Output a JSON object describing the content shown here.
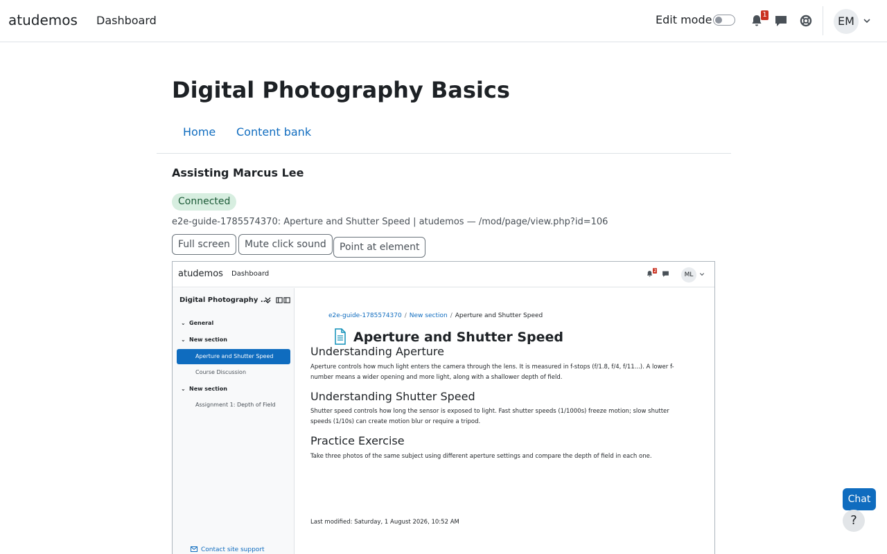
{
  "topbar": {
    "brand": "atudemos",
    "nav_dashboard": "Dashboard",
    "edit_mode_label": "Edit mode",
    "notification_count": "1",
    "user_initials": "EM"
  },
  "page": {
    "title": "Digital Photography Basics",
    "nav": {
      "home": "Home",
      "content_bank": "Content bank"
    }
  },
  "assist": {
    "title": "Assisting Marcus Lee",
    "status": "Connected",
    "location": "e2e-guide-1785574370: Aperture and Shutter Speed | atudemos — /mod/page/view.php?id=106",
    "buttons": {
      "full_screen": "Full screen",
      "mute_click": "Mute click sound",
      "point_element": "Point at element"
    }
  },
  "frame": {
    "brand": "atudemos",
    "nav_dashboard": "Dashboard",
    "notification_count": "2",
    "user_initials": "ML",
    "sidebar": {
      "course": "Digital Photography ...",
      "sections": [
        {
          "label": "General"
        },
        {
          "label": "New section"
        },
        {
          "label": "New section"
        }
      ],
      "items": [
        {
          "label": "Aperture and Shutter Speed"
        },
        {
          "label": "Course Discussion"
        },
        {
          "label": "Assignment 1: Depth of Field"
        }
      ]
    },
    "breadcrumb": {
      "course": "e2e-guide-1785574370",
      "section": "New section",
      "current": "Aperture and Shutter Speed"
    },
    "page_title": "Aperture and Shutter Speed",
    "content": {
      "h1": "Understanding Aperture",
      "p1": "Aperture controls how much light enters the camera through the lens. It is measured in f-stops (f/1.8, f/4, f/11...). A lower f-number means a wider opening and more light, along with a shallower depth of field.",
      "h2": "Understanding Shutter Speed",
      "p2": "Shutter speed controls how long the sensor is exposed to light. Fast shutter speeds (1/1000s) freeze motion; slow shutter speeds (1/10s) can create motion blur or require a tripod.",
      "h3": "Practice Exercise",
      "p3": "Take three photos of the same subject using different aperture settings and compare the depth of field in each one.",
      "last_modified": "Last modified: Saturday, 1 August 2026, 10:52 AM"
    },
    "support_link": "Contact site support"
  },
  "floating": {
    "chat": "Chat",
    "help": "?"
  },
  "colors": {
    "link": "#0f6cbf",
    "connected_bg": "#d7eee0",
    "badge": "#ca3120"
  }
}
